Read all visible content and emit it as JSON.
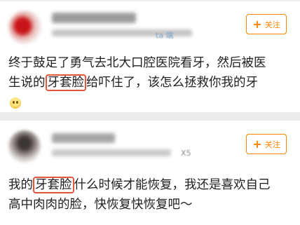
{
  "posts": [
    {
      "meta_tail": "ta 端",
      "follow_label": "关注",
      "content": {
        "line1": "终于鼓足了勇气去北大口腔医院看牙，然后被医",
        "line2_pre": "生说的",
        "line2_highlight": "牙套脸",
        "line2_post": "给吓住了，该怎么拯救你我的牙",
        "emoji": "sweat-smile-icon"
      }
    },
    {
      "meta_tail": "X5",
      "follow_label": "关注",
      "content": {
        "line1_pre": "我的",
        "line1_highlight": "牙套脸",
        "line1_post": "什么时候才能恢复，我还是喜欢自己",
        "line2": "高中肉肉的脸，快恢复快恢复吧～"
      }
    }
  ],
  "colors": {
    "accent": "#ff8200",
    "highlight_border": "#e0563f",
    "background": "#ececec"
  }
}
